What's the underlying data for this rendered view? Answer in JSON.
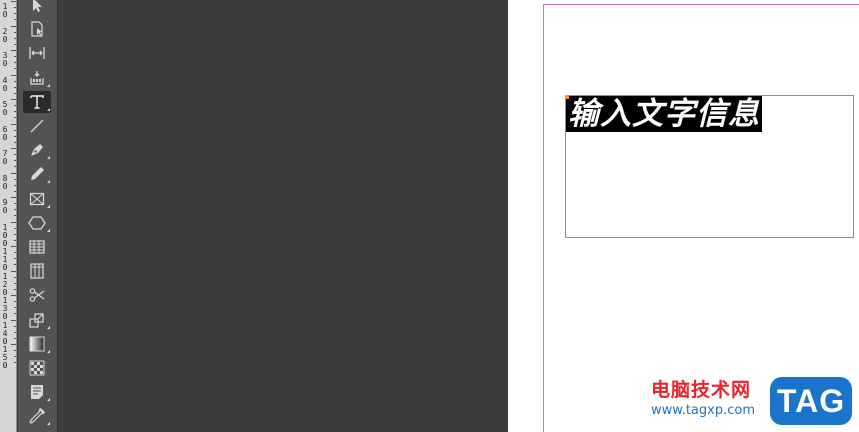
{
  "ruler": {
    "labels": [
      "1\n0",
      "2\n0",
      "3\n0",
      "4\n0",
      "5\n0",
      "6\n0",
      "7\n0",
      "8\n0",
      "9\n0",
      "1\n0\n0",
      "1\n1\n0",
      "1\n2\n0",
      "1\n3\n0",
      "1\n4\n0",
      "1\n5\n0"
    ]
  },
  "tools": [
    {
      "name": "selection-tool",
      "icon": "arrow-icon"
    },
    {
      "name": "direct-selection-tool",
      "icon": "page-select-icon"
    },
    {
      "name": "gap-tool",
      "icon": "gap-icon"
    },
    {
      "name": "content-collector-tool",
      "icon": "collector-icon"
    },
    {
      "name": "type-tool",
      "icon": "type-icon",
      "active": true
    },
    {
      "name": "line-tool",
      "icon": "line-icon"
    },
    {
      "name": "pen-tool",
      "icon": "pen-icon"
    },
    {
      "name": "pencil-tool",
      "icon": "pencil-icon"
    },
    {
      "name": "rectangle-frame-tool",
      "icon": "frame-x-icon"
    },
    {
      "name": "polygon-tool",
      "icon": "hexagon-icon"
    },
    {
      "name": "table-rows-tool",
      "icon": "table-rows-icon"
    },
    {
      "name": "table-columns-tool",
      "icon": "table-columns-icon"
    },
    {
      "name": "scissors-tool",
      "icon": "scissors-icon"
    },
    {
      "name": "free-transform-tool",
      "icon": "transform-icon"
    },
    {
      "name": "gradient-swatch-tool",
      "icon": "gradient-icon"
    },
    {
      "name": "gradient-feather-tool",
      "icon": "feather-icon"
    },
    {
      "name": "note-tool",
      "icon": "note-icon"
    },
    {
      "name": "eyedropper-tool",
      "icon": "eyedropper-icon"
    }
  ],
  "document": {
    "frame_text": "输入文字信息"
  },
  "watermark": {
    "site_name": "电脑技术网",
    "url": "www.tagxp.com",
    "badge": "TAG"
  },
  "colors": {
    "accent_frame": "#5b9bd5",
    "page_margin": "#c47ab7",
    "watermark_red": "#e8242c",
    "watermark_blue": "#1a74c9"
  }
}
